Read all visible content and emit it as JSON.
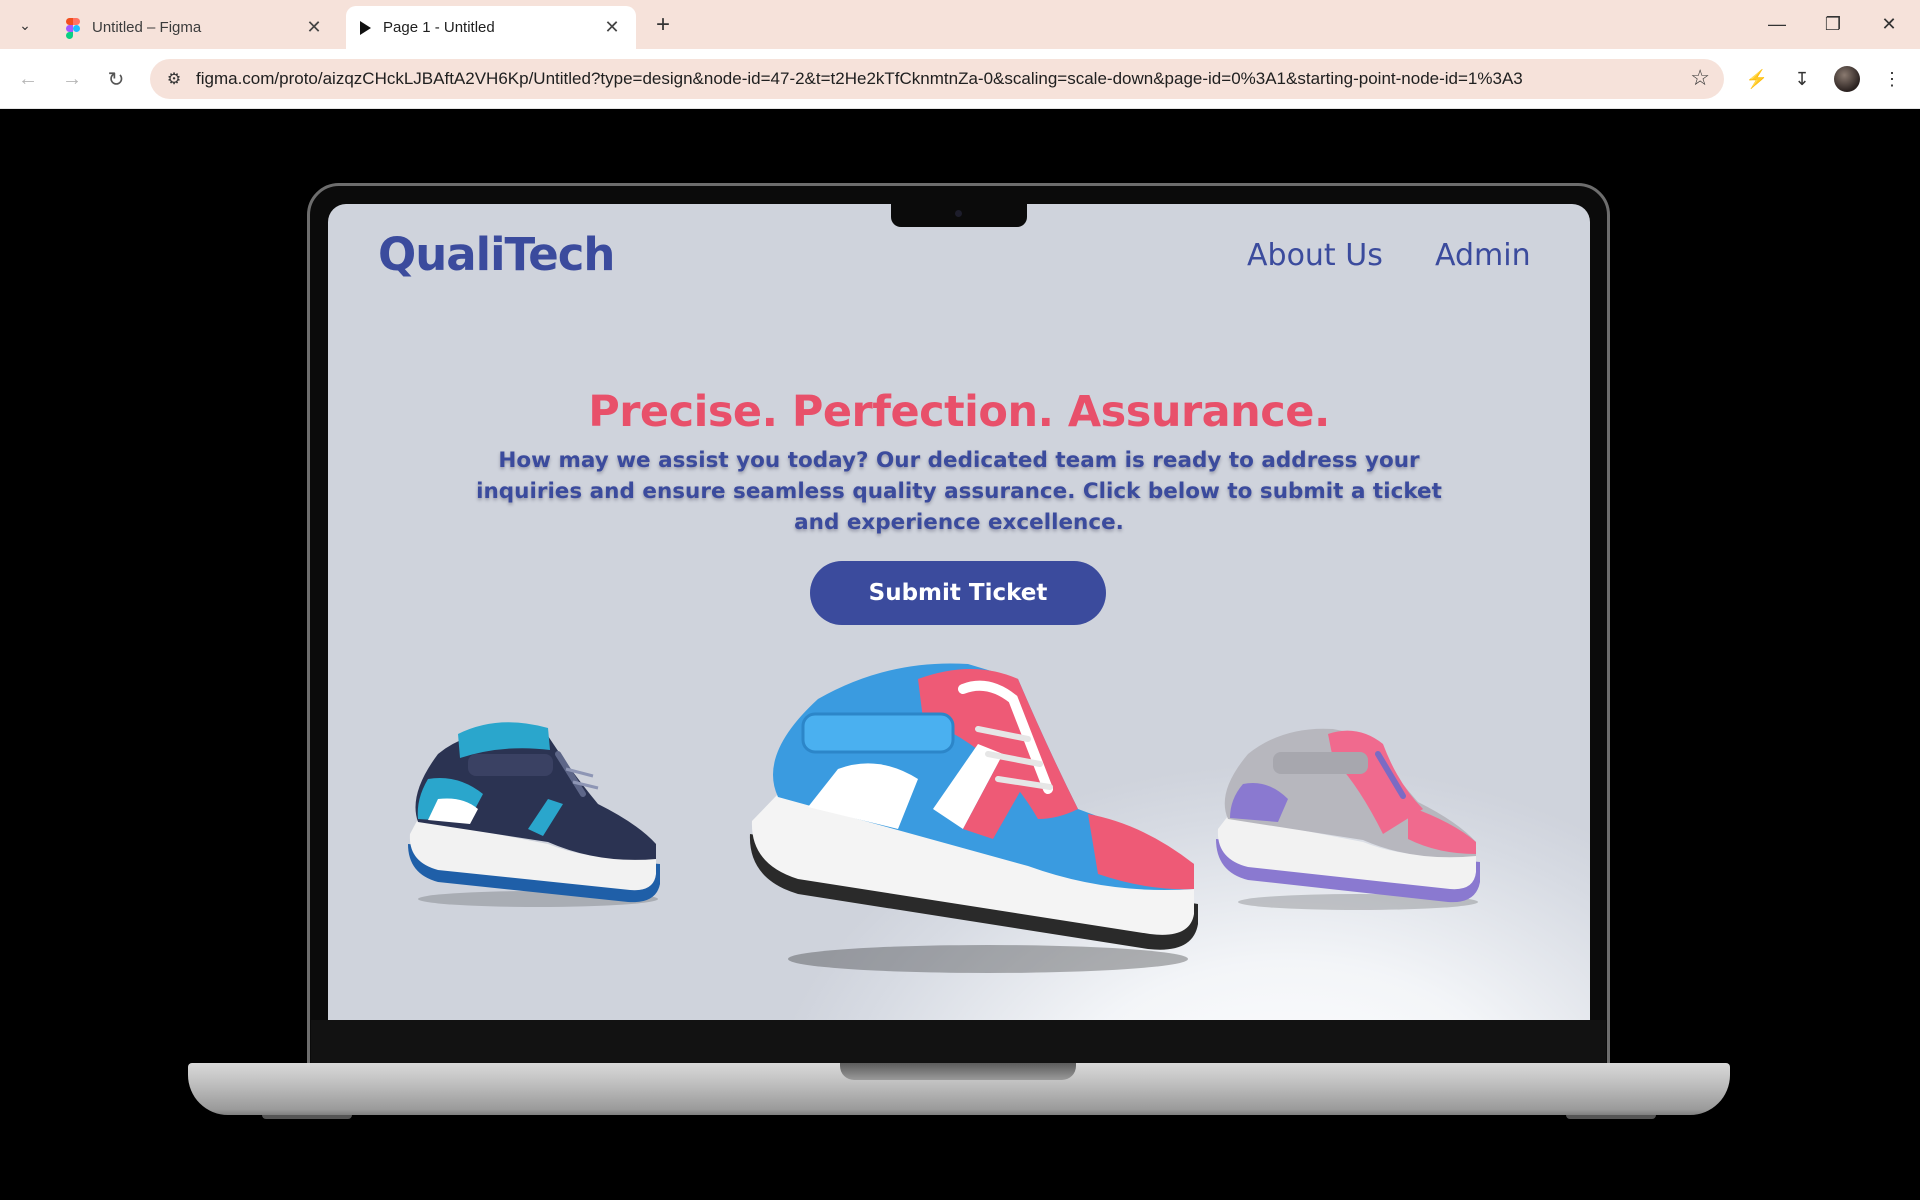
{
  "browser": {
    "tabs": [
      {
        "title": "Untitled – Figma",
        "icon": "figma-icon",
        "active": false
      },
      {
        "title": "Page 1 - Untitled",
        "icon": "play-icon",
        "active": true
      }
    ],
    "url": "figma.com/proto/aizqzCHckLJBAftA2VH6Kp/Untitled?type=design&node-id=47-2&t=t2He2kTfCknmtnZa-0&scaling=scale-down&page-id=0%3A1&starting-point-node-id=1%3A3",
    "colors": {
      "tabbar": "#f6e2da",
      "omnibox": "#f6e2da"
    }
  },
  "site": {
    "brand": "QualiTech",
    "nav": [
      {
        "label": "About Us"
      },
      {
        "label": "Admin"
      }
    ],
    "headline": "Precise. Perfection. Assurance.",
    "subtext": "How may we assist you today? Our dedicated team is ready to address your inquiries and ensure seamless quality assurance. Click below to submit a ticket and experience excellence.",
    "cta_label": "Submit Ticket",
    "colors": {
      "brand": "#3b4b9d",
      "accent": "#e8506a",
      "button": "#3b4b9d"
    },
    "shoes": [
      {
        "name": "navy-teal-sneaker",
        "colors": [
          "#2b3352",
          "#2aa6cc",
          "#ffffff"
        ]
      },
      {
        "name": "blue-pink-sneaker",
        "colors": [
          "#3a9be0",
          "#ee5a76",
          "#ffffff"
        ]
      },
      {
        "name": "grey-pink-sneaker",
        "colors": [
          "#b7b7be",
          "#f06a8e",
          "#8a79d0"
        ]
      }
    ]
  }
}
